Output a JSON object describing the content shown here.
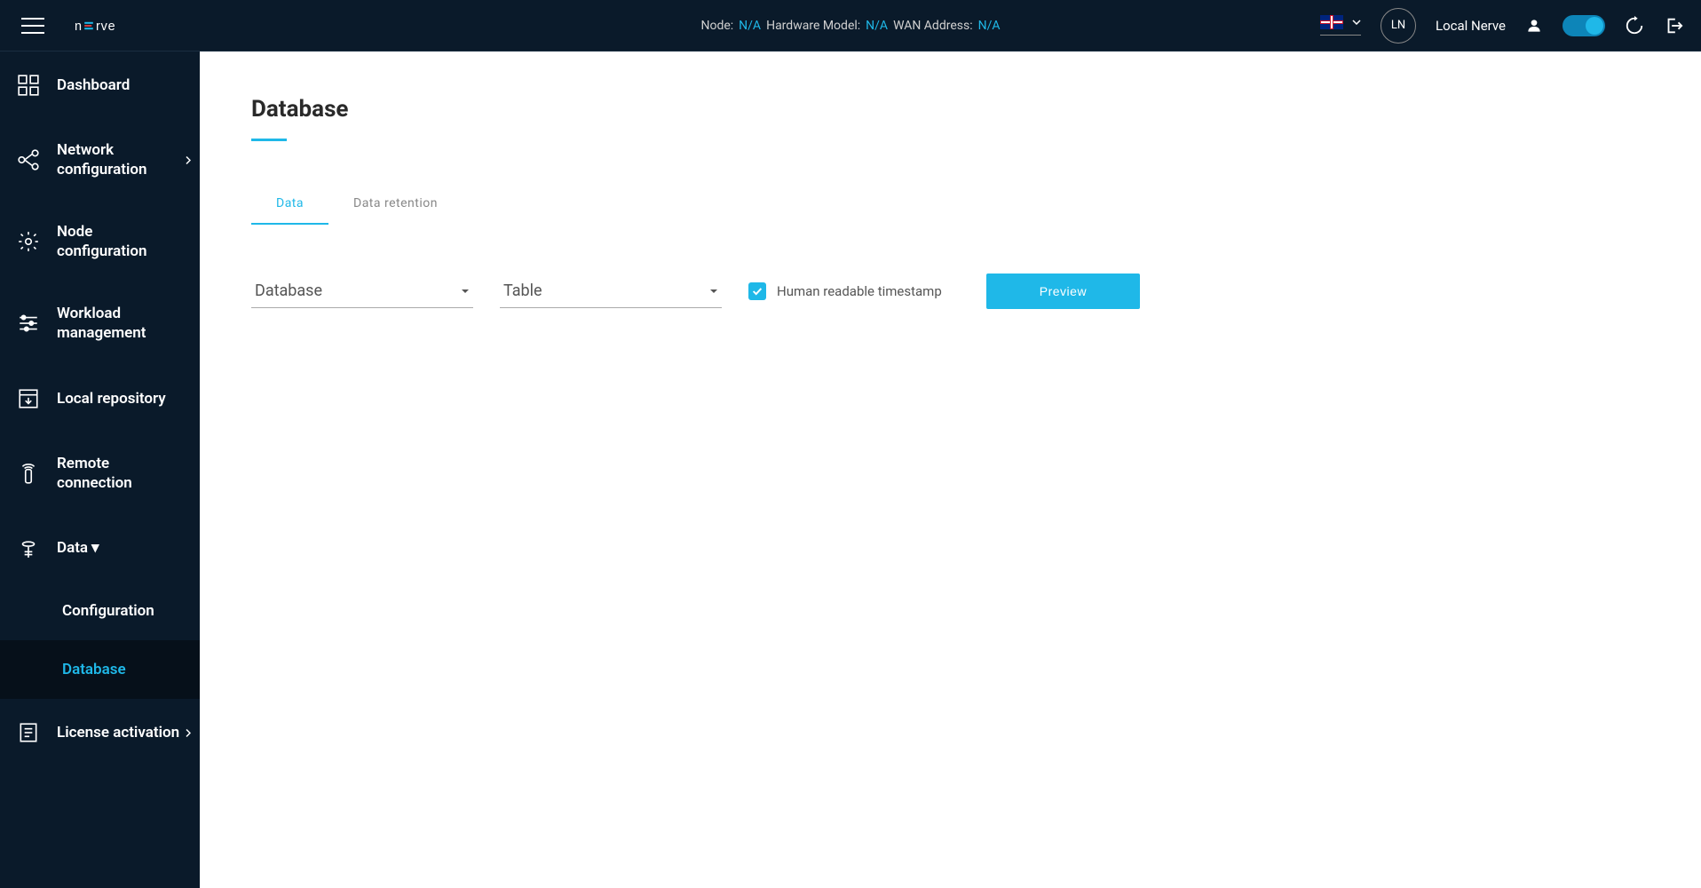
{
  "header": {
    "node_label": "Node:",
    "node_value": "N/A",
    "hw_label": "Hardware Model:",
    "hw_value": "N/A",
    "wan_label": "WAN Address:",
    "wan_value": "N/A",
    "avatar_initials": "LN",
    "user_label": "Local Nerve"
  },
  "sidebar": {
    "items": [
      {
        "label": "Dashboard"
      },
      {
        "label": "Network configuration"
      },
      {
        "label": "Node configuration"
      },
      {
        "label": "Workload management"
      },
      {
        "label": "Local repository"
      },
      {
        "label": "Remote connection"
      },
      {
        "label": "Data"
      },
      {
        "label": "Configuration"
      },
      {
        "label": "Database"
      },
      {
        "label": "License activation"
      }
    ]
  },
  "main": {
    "title": "Database",
    "tabs": [
      {
        "label": "Data"
      },
      {
        "label": "Data retention"
      }
    ],
    "database_select": "Database",
    "table_select": "Table",
    "checkbox_label": "Human readable timestamp",
    "preview_button": "Preview"
  }
}
